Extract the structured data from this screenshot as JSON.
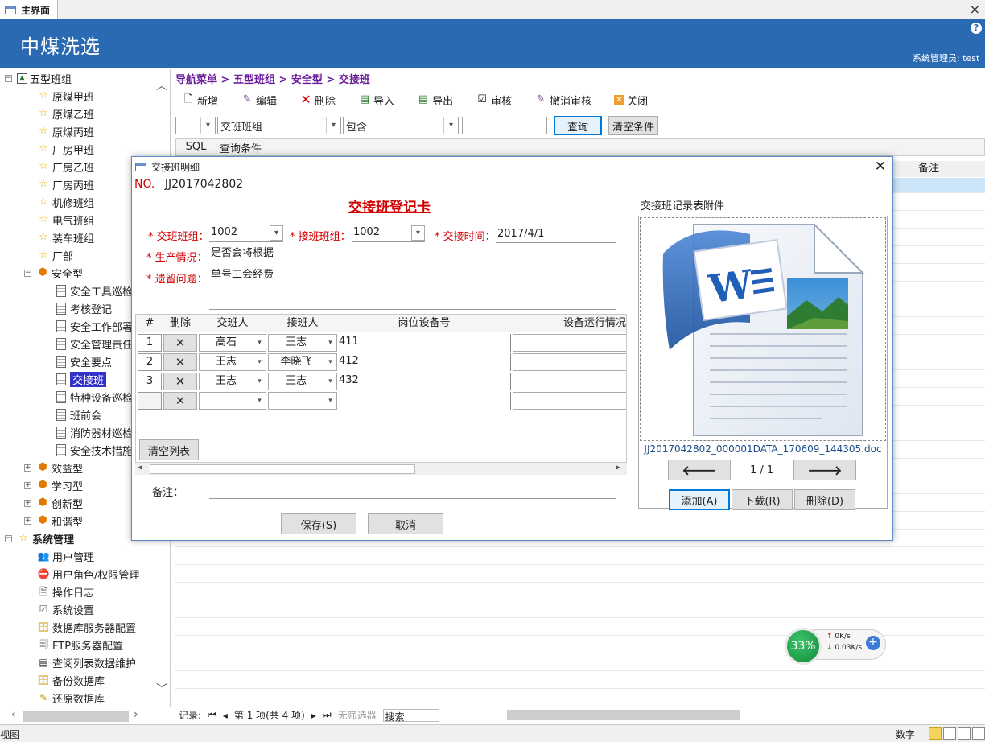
{
  "window": {
    "tab_title": "主界面",
    "close_label": "×"
  },
  "header": {
    "app_title": "中煤洗选",
    "user_text": "系统管理员: test",
    "help": "?"
  },
  "tree": {
    "root1": "五型班组",
    "teams": [
      "原煤甲班",
      "原煤乙班",
      "原煤丙班",
      "厂房甲班",
      "厂房乙班",
      "厂房丙班",
      "机修班组",
      "电气班组",
      "装车班组",
      "厂部"
    ],
    "safety": "安全型",
    "safety_items": [
      "安全工具巡检",
      "考核登记",
      "安全工作部署",
      "安全管理责任",
      "安全要点",
      "交接班",
      "特种设备巡检",
      "班前会",
      "消防器材巡检",
      "安全技术措施"
    ],
    "benefit": "效益型",
    "learning": "学习型",
    "innovation": "创新型",
    "harmony": "和谐型",
    "root2": "系统管理",
    "sys_items": [
      "用户管理",
      "用户角色/权限管理",
      "操作日志",
      "系统设置",
      "数据库服务器配置",
      "FTP服务器配置",
      "查阅列表数据维护",
      "备份数据库",
      "还原数据库"
    ]
  },
  "breadcrumb": "导航菜单 > 五型班组 > 安全型 > 交接班",
  "toolbar": {
    "new": "新增",
    "edit": "编辑",
    "delete": "删除",
    "import": "导入",
    "export": "导出",
    "audit": "审核",
    "unaudit": "撤消审核",
    "close": "关闭"
  },
  "filter": {
    "field": "交班班组",
    "op": "包含",
    "value": "",
    "query": "查询",
    "clear": "清空条件"
  },
  "sql": {
    "label": "SQL",
    "text": "查询条件"
  },
  "grid": {
    "remark_header": "备注"
  },
  "nav": {
    "record_label": "记录:",
    "position": "第 1 项(共 4 项)",
    "no_filter": "无筛选器",
    "search": "搜索"
  },
  "status": {
    "left": "视图",
    "right": "数字"
  },
  "net": {
    "percent": "33%",
    "up": "0K/s",
    "down": "0.03K/s"
  },
  "dialog": {
    "title": "交接班明细",
    "no_label": "NO.",
    "no_value": "JJ2017042802",
    "card_title": "交接班登记卡",
    "hand_team_label": "* 交班班组：",
    "hand_team": "1002",
    "recv_team_label": "* 接班班组：",
    "recv_team": "1002",
    "time_label": "* 交接时间：",
    "time": "2017/4/1",
    "production_label": "* 生产情况：",
    "production": "是否会将根据",
    "issues_label": "* 遗留问题：",
    "issues": "单号工会经费",
    "table": {
      "headers": [
        "#",
        "删除",
        "交班人",
        "接班人",
        "岗位设备号",
        "设备运行情况"
      ],
      "rows": [
        {
          "num": "1",
          "giver": "高石",
          "receiver": "王志",
          "device": "411"
        },
        {
          "num": "2",
          "giver": "王志",
          "receiver": "李晓飞",
          "device": "412"
        },
        {
          "num": "3",
          "giver": "王志",
          "receiver": "王志",
          "device": "432"
        }
      ],
      "clear_list": "清空列表"
    },
    "remark_label": "备注：",
    "save": "保存(S)",
    "cancel": "取消",
    "attach": {
      "title": "交接班记录表附件",
      "file": "JJ2017042802_000001DATA_170609_144305.doc",
      "page": "1 / 1",
      "add": "添加(A)",
      "download": "下载(R)",
      "remove": "删除(D)"
    }
  },
  "icons": {
    "star": "star-icon",
    "doc": "document-icon",
    "shield": "shield-icon"
  },
  "colors": {
    "header_blue": "#2a6ab3",
    "required_red": "#d40000",
    "breadcrumb_purple": "#6a1b9a"
  }
}
